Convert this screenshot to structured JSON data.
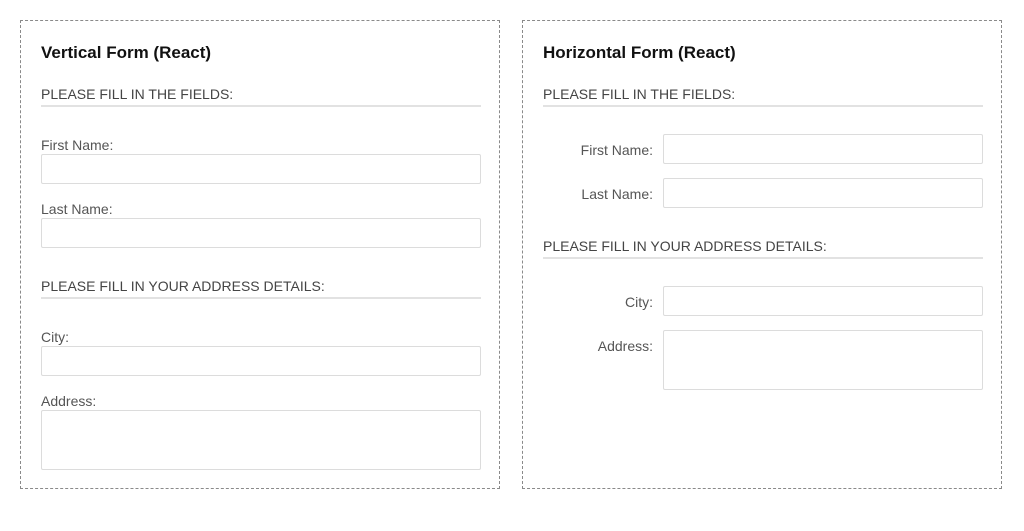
{
  "vertical_form": {
    "title": "Vertical Form (React)",
    "section_fields": "PLEASE FILL IN THE FIELDS:",
    "first_name_label": "First Name:",
    "last_name_label": "Last Name:",
    "section_address": "PLEASE FILL IN YOUR ADDRESS DETAILS:",
    "city_label": "City:",
    "address_label": "Address:",
    "first_name_value": "",
    "last_name_value": "",
    "city_value": "",
    "address_value": ""
  },
  "horizontal_form": {
    "title": "Horizontal Form (React)",
    "section_fields": "PLEASE FILL IN THE FIELDS:",
    "first_name_label": "First Name:",
    "last_name_label": "Last Name:",
    "section_address": "PLEASE FILL IN YOUR ADDRESS DETAILS:",
    "city_label": "City:",
    "address_label": "Address:",
    "first_name_value": "",
    "last_name_value": "",
    "city_value": "",
    "address_value": ""
  }
}
